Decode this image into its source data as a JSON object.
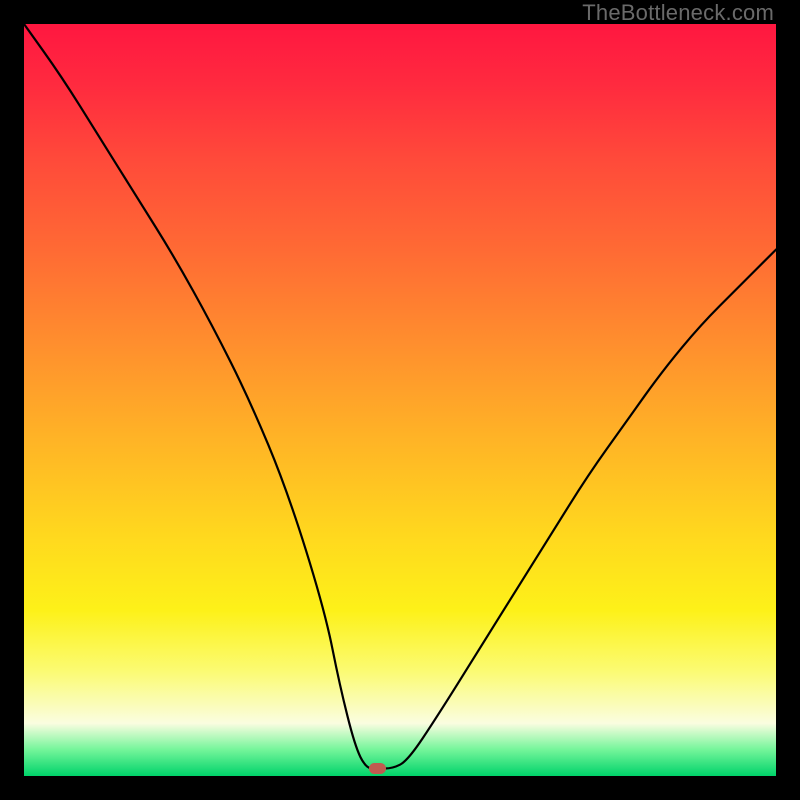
{
  "watermark": "TheBottleneck.com",
  "chart_data": {
    "type": "line",
    "title": "",
    "xlabel": "",
    "ylabel": "",
    "xlim": [
      0,
      100
    ],
    "ylim": [
      0,
      100
    ],
    "series": [
      {
        "name": "bottleneck-curve",
        "x": [
          0,
          5,
          10,
          15,
          20,
          25,
          30,
          35,
          40,
          42,
          44,
          45.5,
          47,
          49,
          51,
          55,
          60,
          65,
          70,
          75,
          80,
          85,
          90,
          95,
          100
        ],
        "values": [
          100,
          93,
          85,
          77,
          69,
          60,
          50,
          38,
          22,
          12,
          4,
          1,
          1,
          1,
          2,
          8,
          16,
          24,
          32,
          40,
          47,
          54,
          60,
          65,
          70
        ]
      }
    ],
    "marker": {
      "x": 47,
      "y": 1
    },
    "gradient_stops": [
      {
        "pos": 0,
        "color": "#ff1740"
      },
      {
        "pos": 50,
        "color": "#ffb326"
      },
      {
        "pos": 80,
        "color": "#fdf119"
      },
      {
        "pos": 100,
        "color": "#00d36a"
      }
    ]
  }
}
